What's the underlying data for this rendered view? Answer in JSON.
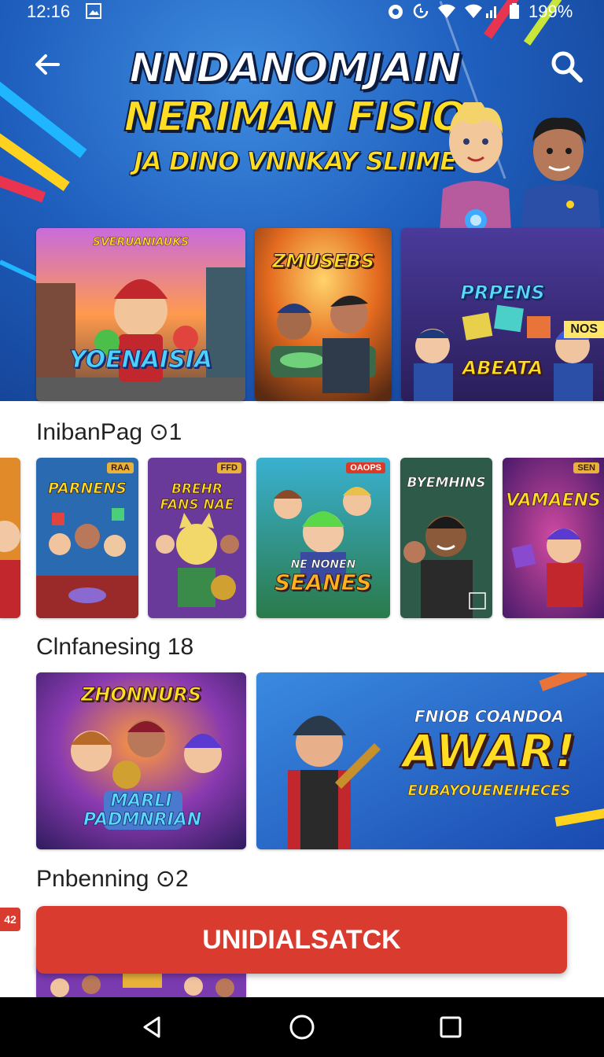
{
  "status_bar": {
    "time": "12:16",
    "battery": "199%",
    "icons": [
      "image-icon",
      "alarm-icon",
      "sync-icon",
      "wifi-icon",
      "signal-icon",
      "battery-icon"
    ]
  },
  "top_bar": {
    "back_icon": "arrow-left-icon",
    "search_icon": "search-icon"
  },
  "hero": {
    "title_line1": "NNDANOMJAIN",
    "title_line2": "NERIMAN FISIO",
    "title_line3": "JA DINO VNNKAY SLIIME",
    "accent": "#ffdd22"
  },
  "featured": [
    {
      "top": "SVERUANIAUKS",
      "title": "YOENAISIA"
    },
    {
      "top": "ZMUSEBS",
      "title": ""
    },
    {
      "top": "PRPENS",
      "title": "ABEATA",
      "tag": "NOS"
    }
  ],
  "sections": [
    {
      "title": "InibanPag ⊙1",
      "cards": [
        {
          "title": "",
          "badge": ""
        },
        {
          "title": "PARNENS",
          "badge": "RAA"
        },
        {
          "title": "BREHR FANS NAE",
          "badge": "FFD"
        },
        {
          "title": "SEANES",
          "sub": "NE NONEN",
          "badge": "OAOPS"
        },
        {
          "title": "BYEMHINS",
          "badge": ""
        },
        {
          "title": "VAMAENS",
          "badge": "SEN"
        }
      ]
    },
    {
      "title": "Clnfanesing 18",
      "cards": [
        {
          "title": "ZHONNURS",
          "sub": "MARLI PADMNRIAN"
        },
        {
          "title": "AWAR!",
          "top": "FNIOB COANDOA",
          "sub": "EUBAYOUENEIHECES"
        }
      ]
    },
    {
      "title": "Pnbenning ⊙2"
    }
  ],
  "cta": {
    "label": "UNIDIALSATCK",
    "color": "#d93b2e"
  },
  "side_tag": "42",
  "nav_bar": {
    "back_icon": "nav-back-icon",
    "home_icon": "nav-home-icon",
    "recents_icon": "nav-recents-icon"
  }
}
